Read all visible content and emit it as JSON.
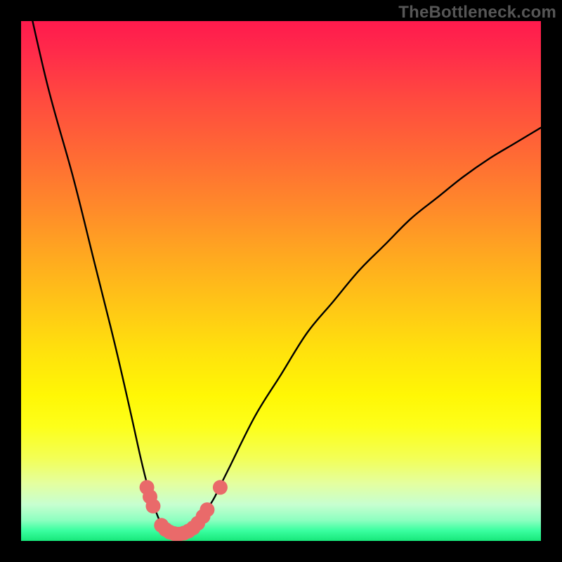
{
  "watermark": "TheBottleneck.com",
  "chart_data": {
    "type": "line",
    "title": "",
    "xlabel": "",
    "ylabel": "",
    "xlim": [
      0,
      100
    ],
    "ylim": [
      0,
      100
    ],
    "grid": false,
    "series": [
      {
        "name": "bottleneck-curve",
        "x": [
          0,
          5,
          10,
          14,
          18,
          21,
          23,
          24.5,
          26,
          27,
          28,
          29,
          30,
          31,
          33,
          34,
          35,
          37,
          38,
          40,
          45,
          50,
          55,
          60,
          65,
          70,
          75,
          80,
          85,
          90,
          95,
          100
        ],
        "values": [
          110,
          88,
          70,
          54,
          38,
          25,
          16,
          10,
          5.5,
          3.2,
          2.0,
          1.5,
          1.2,
          1.5,
          2.0,
          3.0,
          4.8,
          8,
          10,
          14,
          24,
          32,
          40,
          46,
          52,
          57,
          62,
          66,
          70,
          73.5,
          76.5,
          79.5
        ]
      }
    ],
    "markers": [
      {
        "name": "left-cluster",
        "color": "#e96a6a",
        "points": [
          {
            "x": 24.2,
            "y": 10.3
          },
          {
            "x": 24.8,
            "y": 8.5
          },
          {
            "x": 25.4,
            "y": 6.7
          },
          {
            "x": 27.0,
            "y": 3.0
          },
          {
            "x": 27.8,
            "y": 2.2
          },
          {
            "x": 28.6,
            "y": 1.7
          },
          {
            "x": 29.5,
            "y": 1.4
          },
          {
            "x": 30.4,
            "y": 1.3
          },
          {
            "x": 31.3,
            "y": 1.5
          },
          {
            "x": 32.2,
            "y": 1.9
          },
          {
            "x": 33.1,
            "y": 2.5
          },
          {
            "x": 34.0,
            "y": 3.4
          },
          {
            "x": 35.0,
            "y": 4.7
          },
          {
            "x": 35.8,
            "y": 6.0
          }
        ]
      },
      {
        "name": "right-outlier",
        "color": "#e96a6a",
        "points": [
          {
            "x": 38.3,
            "y": 10.3
          }
        ]
      }
    ],
    "gradient_stops": [
      {
        "pos": 0,
        "color": "#ff1a4d"
      },
      {
        "pos": 50,
        "color": "#ffc716"
      },
      {
        "pos": 78,
        "color": "#fdff1a"
      },
      {
        "pos": 100,
        "color": "#17e77a"
      }
    ]
  }
}
